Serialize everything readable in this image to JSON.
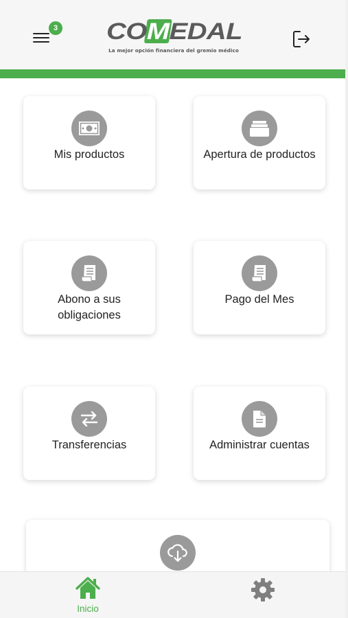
{
  "header": {
    "menu_badge": "3",
    "logo_text": "COMEDAL",
    "logo_tagline": "La mejor opción financiera del gremio médico"
  },
  "cards": [
    {
      "label": "Mis productos",
      "icon": "money-icon"
    },
    {
      "label": "Apertura de productos",
      "icon": "folder-icon"
    },
    {
      "label_line1": "Abono a sus",
      "label_line2": "obligaciones",
      "icon": "receipt-icon"
    },
    {
      "label": "Pago del Mes",
      "icon": "receipt-icon"
    },
    {
      "label": "Transferencias",
      "icon": "transfer-arrows-icon"
    },
    {
      "label": "Administrar cuentas",
      "icon": "document-icon"
    }
  ],
  "partial_card": {
    "icon": "cloud-download-icon"
  },
  "bottom_nav": {
    "home_label": "Inicio",
    "settings_icon": "gear-icon"
  },
  "colors": {
    "brand_green": "#4cae4c",
    "icon_gray": "#9a9a9a",
    "logo_gray": "#5a5a5a"
  }
}
